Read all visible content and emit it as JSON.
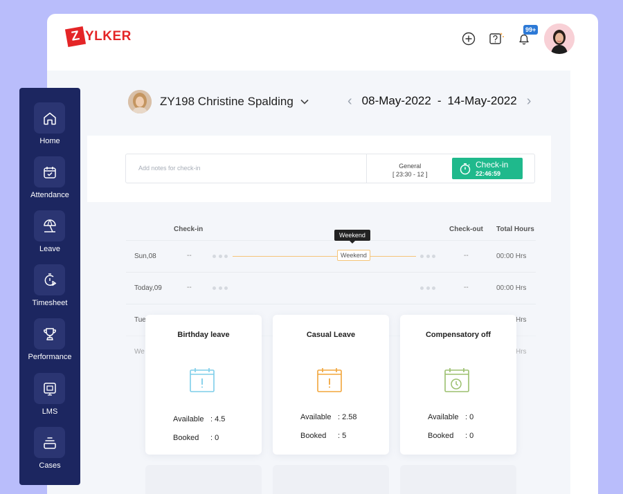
{
  "brand": {
    "logo_letter": "Z",
    "logo_rest": "YLKER",
    "color": "#e42527"
  },
  "header": {
    "icons": [
      "add-circle-icon",
      "help-icon",
      "notification-icon"
    ],
    "notification_badge": "99+"
  },
  "employee": {
    "name": "ZY198 Christine Spalding"
  },
  "date_range": {
    "start": "08-May-2022",
    "separator": "-",
    "end": "14-May-2022"
  },
  "checkin": {
    "notes_placeholder": "Add notes for check-in",
    "shift_name": "General",
    "shift_time": "[ 23:30 - 12 ]",
    "button_label": "Check-in",
    "timer": "22:46:59",
    "button_color": "#1fb98c"
  },
  "table": {
    "headers": {
      "checkin": "Check-in",
      "checkout": "Check-out",
      "total": "Total Hours"
    },
    "rows": [
      {
        "day": "Sun,08",
        "in": "--",
        "out": "--",
        "hours": "00:00 Hrs",
        "label": "Weekend",
        "tooltip": "Weekend"
      },
      {
        "day": "Today,09",
        "in": "--",
        "out": "--",
        "hours": "00:00 Hrs"
      },
      {
        "day": "Tue",
        "hours": "Hrs"
      },
      {
        "day": "We",
        "hours": "Hrs"
      }
    ]
  },
  "leave_cards": [
    {
      "title": "Birthday leave",
      "available_label": "Available",
      "available": ": 4.5",
      "booked_label": "Booked",
      "booked": ": 0",
      "color": "#7dcde9",
      "icon": "calendar-alert-icon"
    },
    {
      "title": "Casual Leave",
      "available_label": "Available",
      "available": ": 2.58",
      "booked_label": "Booked",
      "booked": ": 5",
      "color": "#f2a53a",
      "icon": "calendar-alert-icon"
    },
    {
      "title": "Compensatory off",
      "available_label": "Available",
      "available": ": 0",
      "booked_label": "Booked",
      "booked": ": 0",
      "color": "#9bbf6e",
      "icon": "calendar-clock-icon"
    }
  ],
  "sidebar": {
    "items": [
      {
        "label": "Home",
        "icon": "home-icon"
      },
      {
        "label": "Attendance",
        "icon": "calendar-check-icon"
      },
      {
        "label": "Leave",
        "icon": "beach-umbrella-icon"
      },
      {
        "label": "Timesheet",
        "icon": "timer-play-icon"
      },
      {
        "label": "Performance",
        "icon": "trophy-icon"
      },
      {
        "label": "LMS",
        "icon": "monitor-icon"
      },
      {
        "label": "Cases",
        "icon": "cases-icon"
      }
    ]
  }
}
